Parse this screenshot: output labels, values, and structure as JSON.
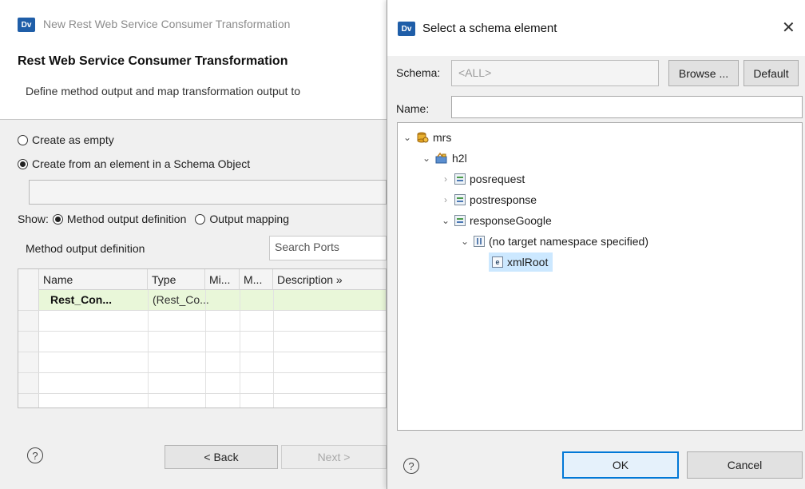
{
  "wizard": {
    "title": "New Rest Web Service Consumer Transformation",
    "logo_text": "Dv",
    "header_title": "Rest Web Service Consumer Transformation",
    "header_desc": "Define method output and map transformation output to",
    "create_empty_label": "Create as empty",
    "create_from_label": "Create from an element in a Schema Object",
    "show_label": "Show:",
    "method_output_def_label": "Method output definition",
    "output_mapping_label": "Output mapping",
    "section_label": "Method output definition",
    "search_placeholder": "Search Ports",
    "table": {
      "columns": [
        "Name",
        "Type",
        "Mi...",
        "M...",
        "Description »"
      ],
      "rows": [
        {
          "name": "Rest_Con...",
          "type": "(Rest_Co..."
        }
      ]
    },
    "back_label": "< Back",
    "next_label": "Next >",
    "help_symbol": "?"
  },
  "dialog": {
    "title": "Select a schema element",
    "logo_text": "Dv",
    "close_symbol": "✕",
    "schema_label": "Schema:",
    "schema_value": "<ALL>",
    "browse_label": "Browse ...",
    "default_label": "Default",
    "name_label": "Name:",
    "name_value": "",
    "tree": {
      "root": "mrs",
      "project": "h2l",
      "schema1": "posrequest",
      "schema2": "postresponse",
      "schema3": "responseGoogle",
      "namespace": "(no target namespace specified)",
      "element": "xmlRoot"
    },
    "ok_label": "OK",
    "cancel_label": "Cancel",
    "help_symbol": "?"
  },
  "colors": {
    "accent": "#0078d7",
    "selection": "#cce8ff",
    "row_highlight": "#e9f7d9",
    "logo": "#1f5ea8"
  }
}
